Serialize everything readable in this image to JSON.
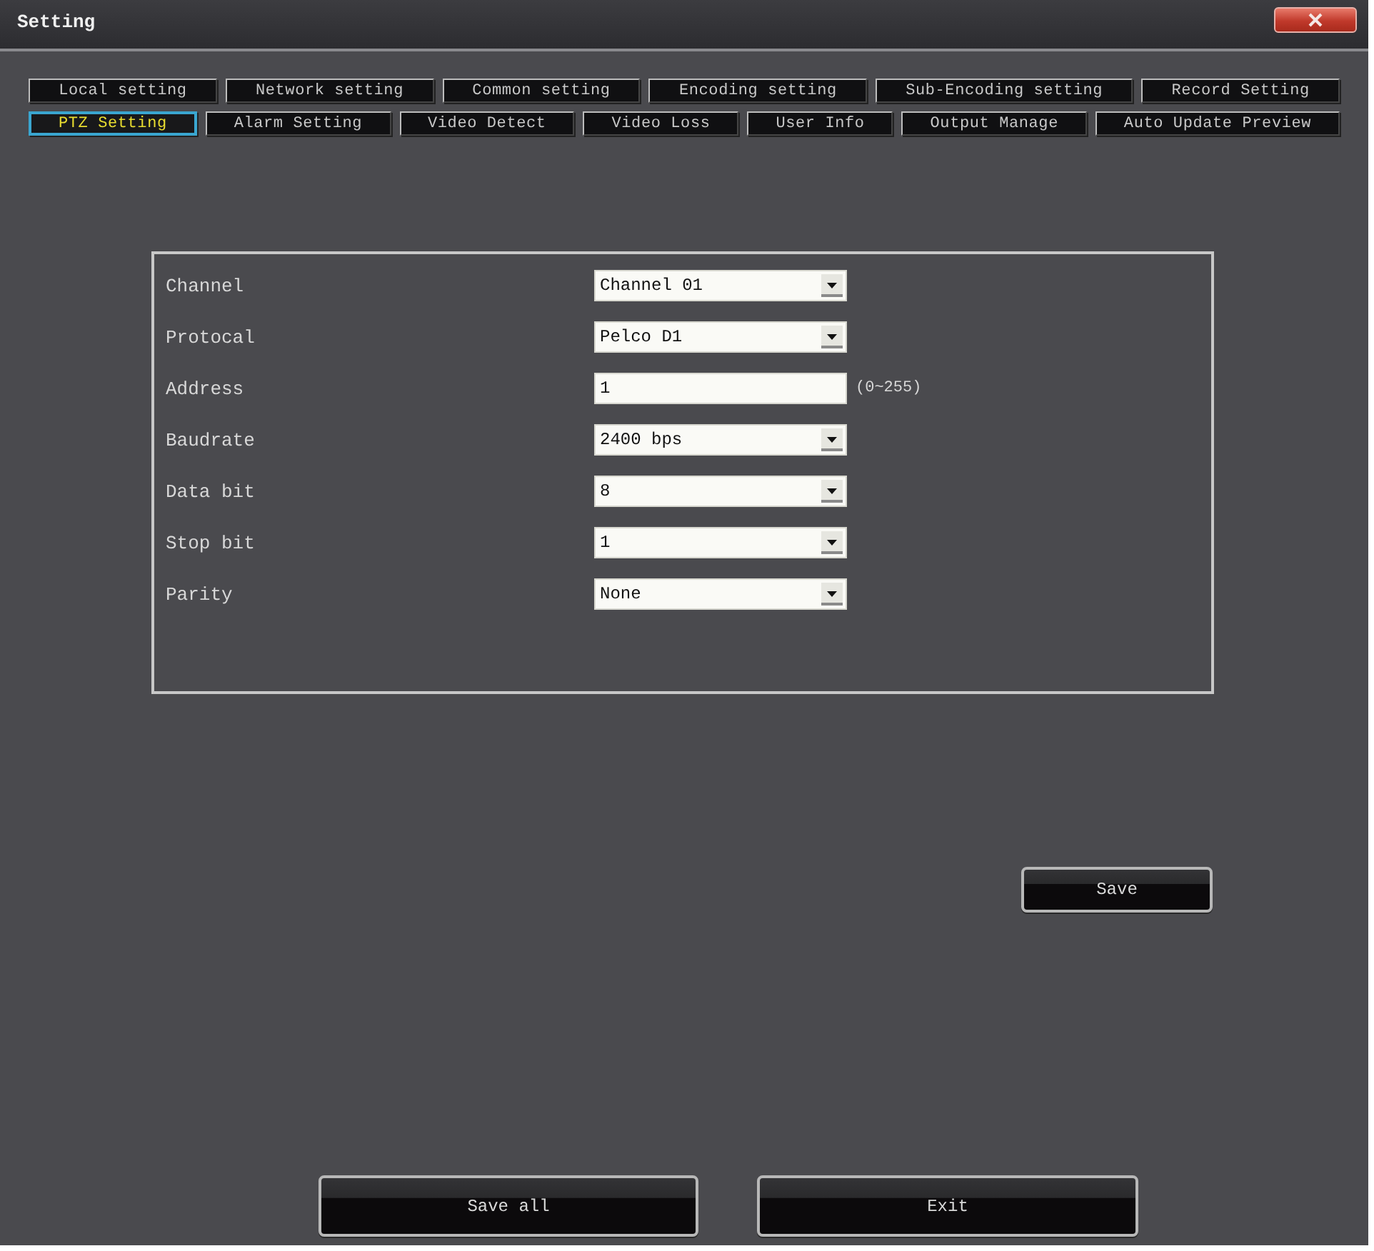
{
  "window": {
    "title": "Setting"
  },
  "tab_rows": [
    {
      "tabs": [
        {
          "label": "Local setting",
          "selected": false
        },
        {
          "label": "Network setting",
          "selected": false
        },
        {
          "label": "Common setting",
          "selected": false
        },
        {
          "label": "Encoding setting",
          "selected": false
        },
        {
          "label": "Sub-Encoding setting",
          "selected": false
        },
        {
          "label": "Record Setting",
          "selected": false
        }
      ]
    },
    {
      "tabs": [
        {
          "label": "PTZ Setting",
          "selected": true
        },
        {
          "label": "Alarm Setting",
          "selected": false
        },
        {
          "label": "Video Detect",
          "selected": false
        },
        {
          "label": "Video Loss",
          "selected": false
        },
        {
          "label": "User Info",
          "selected": false
        },
        {
          "label": "Output Manage",
          "selected": false
        },
        {
          "label": "Auto Update Preview",
          "selected": false
        }
      ]
    }
  ],
  "form": {
    "fields": [
      {
        "label": "Channel",
        "kind": "select",
        "value": "Channel 01"
      },
      {
        "label": "Protocal",
        "kind": "select",
        "value": "Pelco D1"
      },
      {
        "label": "Address",
        "kind": "text",
        "value": "1",
        "hint": "(0~255)"
      },
      {
        "label": "Baudrate",
        "kind": "select",
        "value": "2400 bps"
      },
      {
        "label": "Data bit",
        "kind": "select",
        "value": "8"
      },
      {
        "label": "Stop bit",
        "kind": "select",
        "value": "1"
      },
      {
        "label": "Parity",
        "kind": "select",
        "value": "None"
      }
    ]
  },
  "save_button": {
    "label": "Save"
  },
  "footer": {
    "save_all_button": {
      "label": "Save all"
    },
    "exit_button": {
      "label": "Exit"
    }
  }
}
